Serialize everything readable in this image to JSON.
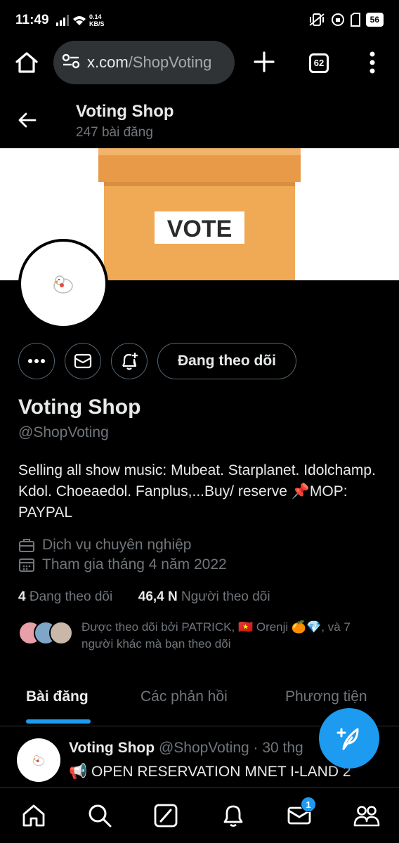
{
  "status_bar": {
    "time": "11:49",
    "speed_value": "0.14",
    "speed_unit": "KB/S",
    "battery": "56"
  },
  "browser": {
    "url_domain": "x.com",
    "url_path": "/ShopVoting",
    "tab_count": "62"
  },
  "header": {
    "title": "Voting Shop",
    "post_count": "247 bài đăng"
  },
  "banner": {
    "sign_text": "VOTE"
  },
  "actions": {
    "follow_label": "Đang theo dõi"
  },
  "profile": {
    "name": "Voting Shop",
    "handle": "@ShopVoting",
    "bio": "Selling all show music: Mubeat. Starplanet. Idolchamp. Kdol. Choeaedol. Fanplus,...Buy/ reserve 📌MOP: PAYPAL",
    "category": "Dịch vụ chuyên nghiệp",
    "joined": "Tham gia tháng 4 năm 2022",
    "following_count": "4",
    "following_label": "Đang theo dõi",
    "followers_count": "46,4 N",
    "followers_label": "Người theo dõi",
    "followed_by": "Được theo dõi bởi PATRICK, 🇻🇳 Orenji 🍊💎, và 7 người khác mà bạn theo dõi"
  },
  "tabs": [
    "Bài đăng",
    "Các phản hồi",
    "Phương tiện"
  ],
  "post": {
    "name": "Voting Shop",
    "meta": "@ShopVoting · 30 thg",
    "text": "📢 OPEN RESERVATION MNET I-LAND 2"
  },
  "nav": {
    "messages_badge": "1"
  },
  "colors": {
    "accent": "#1d9bf0",
    "background": "#000000",
    "secondary_text": "#71767b",
    "ballot_box": "#f0a955"
  }
}
